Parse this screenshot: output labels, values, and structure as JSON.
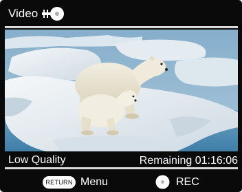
{
  "header": {
    "title": "Video",
    "icon": "video-plug-icon"
  },
  "preview": {
    "subject": "polar-bear-mother-and-cub-on-ice",
    "colors": {
      "sky": "#8cb4cf",
      "ice": "#e9eef2",
      "water": "#4f8db4"
    }
  },
  "status": {
    "quality": "Low Quality",
    "remaining": "Remaining 01:16:06"
  },
  "footer": {
    "return_key": "RETURN",
    "menu_label": "Menu",
    "rec_icon": "rec-button-icon",
    "rec_label": "REC"
  }
}
